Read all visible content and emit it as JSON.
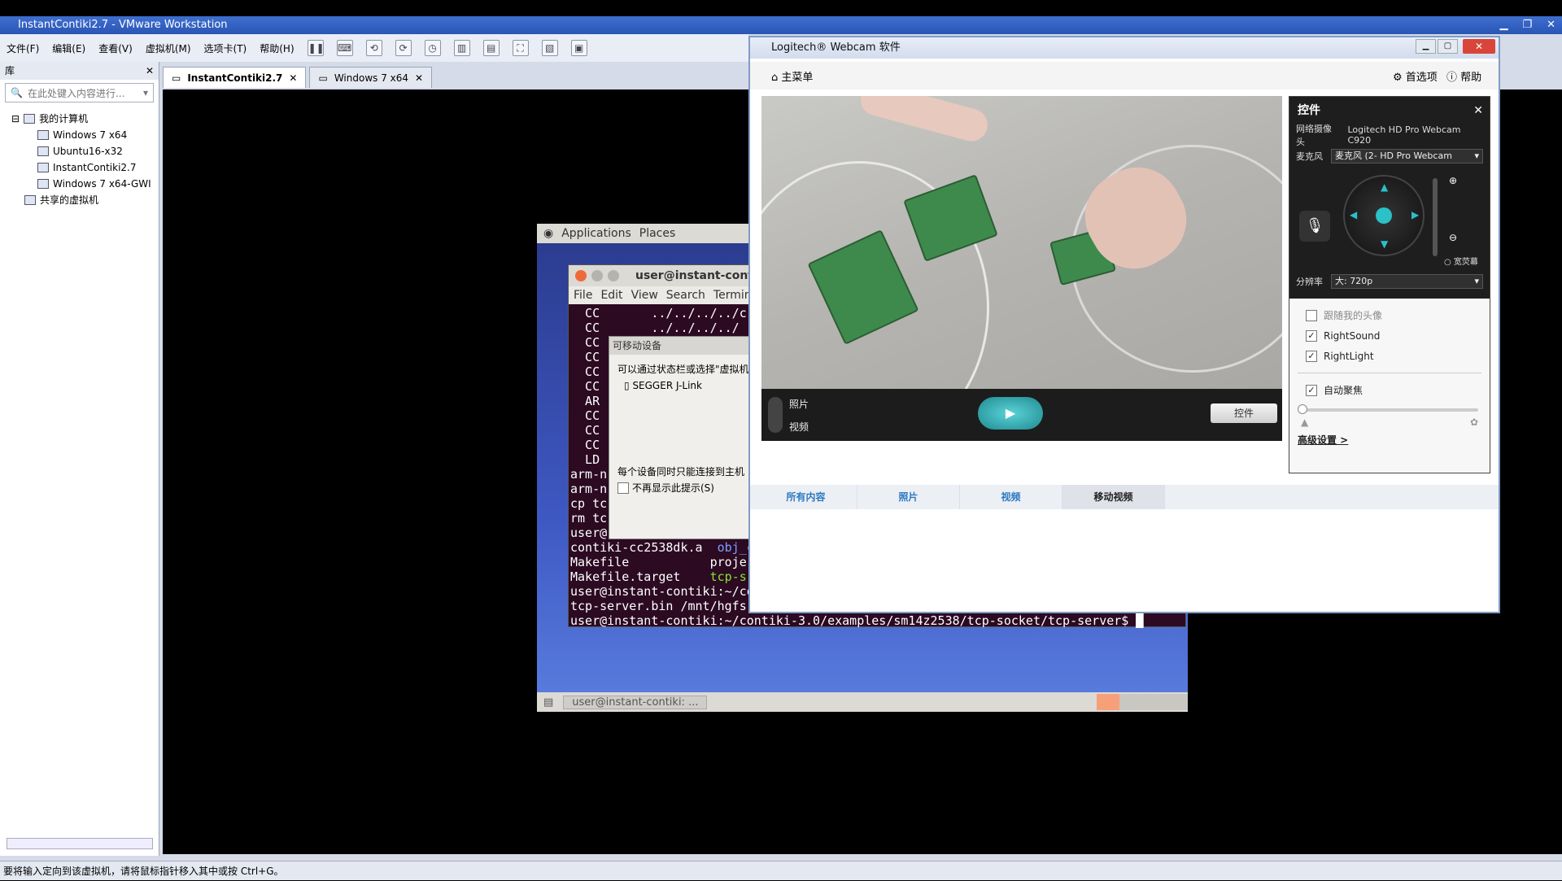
{
  "vmware": {
    "title": "InstantContiki2.7 - VMware Workstation",
    "menu": [
      "文件(F)",
      "编辑(E)",
      "查看(V)",
      "虚拟机(M)",
      "选项卡(T)",
      "帮助(H)"
    ],
    "library": {
      "title": "库",
      "search_placeholder": "在此处键入内容进行...",
      "my_computer": "我的计算机",
      "vms": [
        "Windows 7 x64",
        "Ubuntu16-x32",
        "InstantContiki2.7",
        "Windows 7 x64-GWI"
      ],
      "shared": "共享的虚拟机"
    },
    "tabs": [
      "InstantContiki2.7",
      "Windows 7 x64"
    ],
    "status": "要将输入定向到该虚拟机，请将鼠标指针移入其中或按 Ctrl+G。"
  },
  "guest": {
    "panel": [
      "Applications",
      "Places"
    ],
    "bottom_task": "user@instant-contiki: ...",
    "terminal": {
      "title": "user@instant-contik",
      "menu": [
        "File",
        "Edit",
        "View",
        "Search",
        "Termin"
      ],
      "lines": [
        "  CC       ../../../../c",
        "  CC       ../../../../",
        "  CC",
        "  CC",
        "  CC",
        "  CC",
        "  AR",
        "  CC",
        "  CC",
        "  CC",
        "  LD",
        "arm-n",
        "arm-n",
        "cp tc",
        "rm tc",
        "user@"
      ],
      "ls_row1_a": "contiki-cc2538dk.a",
      "ls_row1_b": "obj_c",
      "ls_row2_a": "Makefile",
      "ls_row2_b": "proje",
      "ls_row3_a": "Makefile.target",
      "ls_row3_b": "tcp-s",
      "line_a": "user@instant-contiki:~/co",
      "line_b": "tcp-server.bin /mnt/hgfs,",
      "prompt": "user@instant-contiki:~/contiki-3.0/examples/sm14z2538/tcp-socket/tcp-server$"
    },
    "device_dialog": {
      "title": "可移动设备",
      "text": "可以通过状态栏或选择\"虚拟机",
      "device": "SEGGER J-Link",
      "note": "每个设备同时只能连接到主机",
      "checkbox": "不再显示此提示(S)"
    }
  },
  "logitech": {
    "title": "Logitech® Webcam 软件",
    "home": "主菜单",
    "prefs": "首选项",
    "help": "帮助",
    "photo": "照片",
    "video": "视频",
    "controls_btn": "控件",
    "panel": {
      "title": "控件",
      "camera_label": "网络摄像头",
      "camera_value": "Logitech HD Pro Webcam C920",
      "mic_label": "麦克风",
      "mic_value": "麦克风 (2- HD Pro Webcam",
      "widescreen": "宽荧幕",
      "res_label": "分辨率",
      "res_value": "大: 720p",
      "follow_face": "跟随我的头像",
      "rightsound": "RightSound",
      "rightlight": "RightLight",
      "autofocus": "自动聚焦",
      "advanced": "高级设置 >"
    },
    "tabs": [
      "所有内容",
      "照片",
      "视频",
      "移动视频"
    ]
  }
}
